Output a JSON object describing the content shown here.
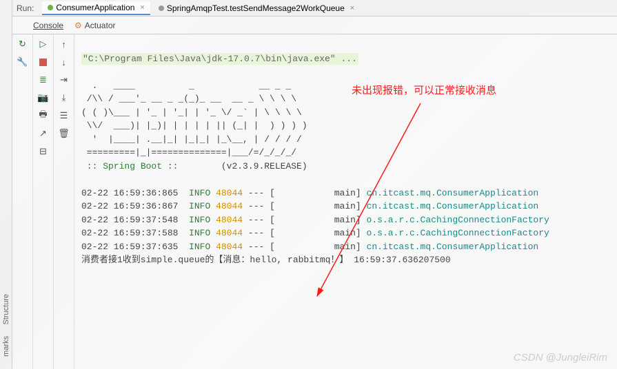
{
  "top": {
    "run_label": "Run:",
    "tabs": [
      {
        "label": "ConsumerApplication",
        "active": true,
        "close": "×"
      },
      {
        "label": "SpringAmqpTest.testSendMessage2WorkQueue",
        "active": false,
        "close": "×"
      }
    ]
  },
  "sub_tabs": {
    "console": "Console",
    "actuator": "Actuator"
  },
  "sidebar_left": {
    "structure": "Structure",
    "bookmarks": "marks"
  },
  "toolbar_col1": {
    "rerun": "↻",
    "wrench": "🔧"
  },
  "toolbar_col2": {
    "run_arrow": "▷",
    "stop": "",
    "debug": "≣",
    "camera": "📷",
    "print": "🖶",
    "open": "↗",
    "collapse": "⊟"
  },
  "toolbar_col3": {
    "up": "↑",
    "down": "↓",
    "wrap": "⇥",
    "scroll": "⤓",
    "filter": "☰",
    "trash": "🗑"
  },
  "console": {
    "command": "\"C:\\Program Files\\Java\\jdk-17.0.7\\bin\\java.exe\" ...",
    "ascii1": "  .   ____          _            __ _ _",
    "ascii2": " /\\\\ / ___'_ __ _ _(_)_ __  __ _ \\ \\ \\ \\",
    "ascii3": "( ( )\\___ | '_ | '_| | '_ \\/ _` | \\ \\ \\ \\",
    "ascii4": " \\\\/  ___)| |_)| | | | | || (_| |  ) ) ) )",
    "ascii5": "  '  |____| .__|_| |_|_| |_\\__, | / / / /",
    "ascii6": " =========|_|==============|___/=/_/_/_/",
    "springboot": " :: Spring Boot ::        ",
    "version": "(v2.3.9.RELEASE)",
    "logs": [
      {
        "ts": "02-22 16:59:36:865",
        "level": "INFO",
        "pid": "48044",
        "sep": " --- [           main] ",
        "cls": "cn.itcast.mq.ConsumerApplication"
      },
      {
        "ts": "02-22 16:59:36:867",
        "level": "INFO",
        "pid": "48044",
        "sep": " --- [           main] ",
        "cls": "cn.itcast.mq.ConsumerApplication"
      },
      {
        "ts": "02-22 16:59:37:548",
        "level": "INFO",
        "pid": "48044",
        "sep": " --- [           main] ",
        "cls": "o.s.a.r.c.CachingConnectionFactory"
      },
      {
        "ts": "02-22 16:59:37:588",
        "level": "INFO",
        "pid": "48044",
        "sep": " --- [           main] ",
        "cls": "o.s.a.r.c.CachingConnectionFactory"
      },
      {
        "ts": "02-22 16:59:37:635",
        "level": "INFO",
        "pid": "48044",
        "sep": " --- [           main] ",
        "cls": "cn.itcast.mq.ConsumerApplication"
      }
    ],
    "receiver_msg": "消费者接1收到simple.queue的【消息：hello, rabbitmq！】 16:59:37.636207500"
  },
  "annotation": "未出现报错，可以正常接收消息",
  "watermark": "CSDN @JungleiRim"
}
